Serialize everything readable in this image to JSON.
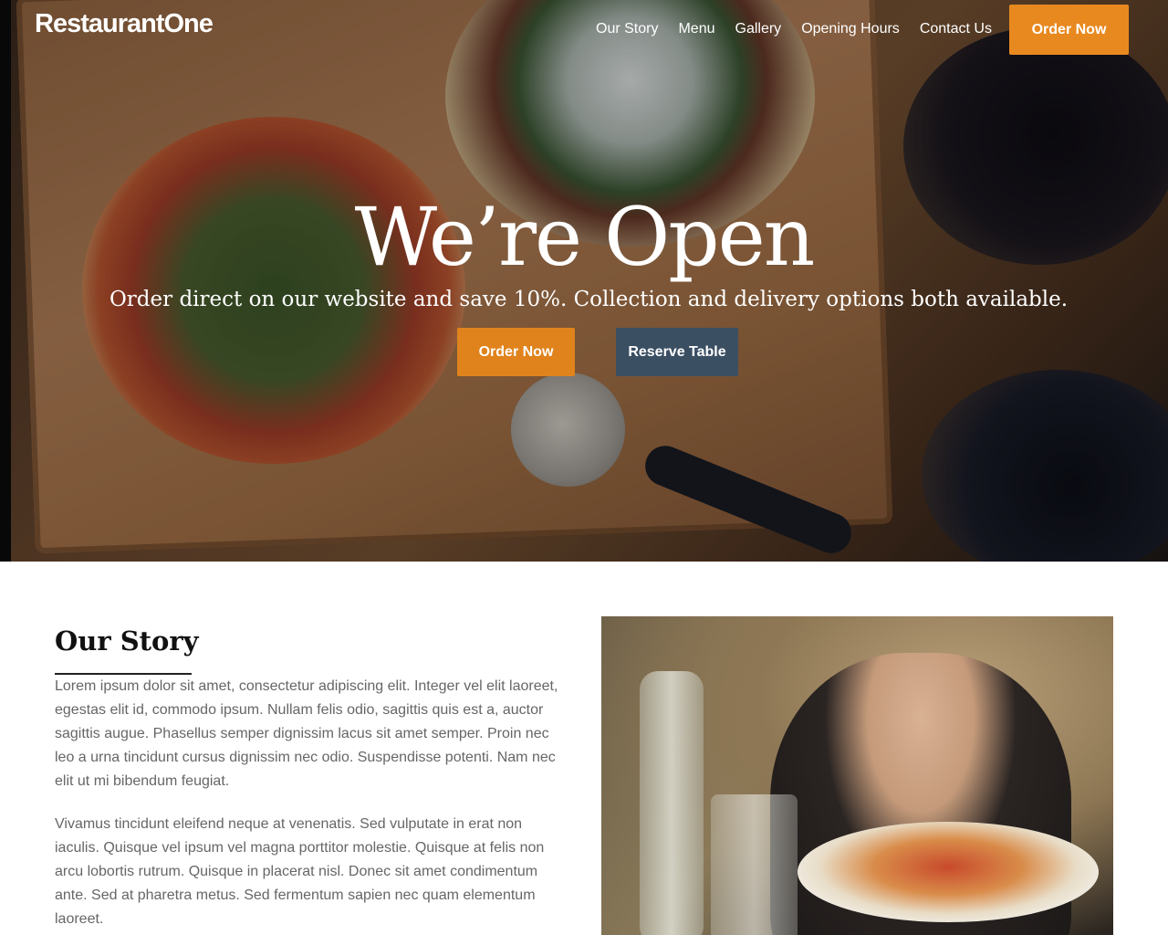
{
  "brand": "RestaurantOne",
  "nav": {
    "items": [
      "Our Story",
      "Menu",
      "Gallery",
      "Opening Hours",
      "Contact Us"
    ],
    "order_label": "Order Now"
  },
  "hero": {
    "title": "We’re Open",
    "subtitle": "Order direct on our website and save 10%. Collection and delivery options both available.",
    "order_button": "Order Now",
    "reserve_button": "Reserve Table"
  },
  "story": {
    "title": "Our Story",
    "paragraphs": [
      "Lorem ipsum dolor sit amet, consectetur adipiscing elit. Integer vel elit laoreet, egestas elit id, commodo ipsum. Nullam felis odio, sagittis quis est a, auctor sagittis augue. Phasellus semper dignissim lacus sit amet semper. Proin nec leo a urna tincidunt cursus dignissim nec odio. Suspendisse potenti. Nam nec elit ut mi bibendum feugiat.",
      "Vivamus tincidunt eleifend neque at venenatis. Sed vulputate in erat non iaculis. Quisque vel ipsum vel magna porttitor molestie. Quisque at felis non arcu lobortis rutrum. Quisque in placerat nisl. Donec sit amet condimentum ante. Sed at pharetra metus. Sed fermentum sapien nec quam elementum laoreet."
    ]
  },
  "colors": {
    "accent": "#e8891f",
    "secondary": "#3b4f63"
  }
}
